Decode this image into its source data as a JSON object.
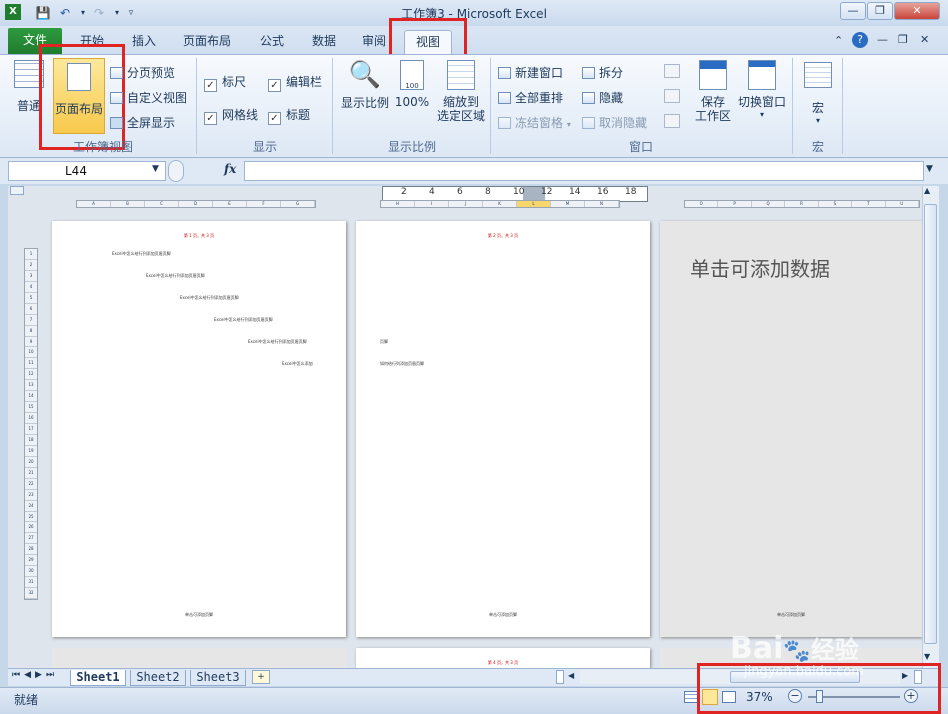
{
  "title": "工作簿3 - Microsoft Excel",
  "tabs": {
    "file": "文件",
    "home": "开始",
    "insert": "插入",
    "layout": "页面布局",
    "formula": "公式",
    "data": "数据",
    "review": "审阅",
    "view": "视图"
  },
  "ribbon": {
    "normal": "普通",
    "page_layout": "页面布局",
    "page_break": "分页预览",
    "custom_view": "自定义视图",
    "full_screen": "全屏显示",
    "group_views": "工作簿视图",
    "ruler": "标尺",
    "formula_bar": "编辑栏",
    "gridlines": "网格线",
    "headings": "标题",
    "group_show": "显示",
    "zoom": "显示比例",
    "zoom100": "100%",
    "zoom_sel_1": "缩放到",
    "zoom_sel_2": "选定区域",
    "group_zoom": "显示比例",
    "new_window": "新建窗口",
    "arrange_all": "全部重排",
    "freeze": "冻结窗格",
    "split": "拆分",
    "hide": "隐藏",
    "unhide": "取消隐藏",
    "save_ws_1": "保存",
    "save_ws_2": "工作区",
    "switch_win": "切换窗口",
    "group_window": "窗口",
    "macros": "宏",
    "group_macros": "宏",
    "icon_100": "100"
  },
  "namebox": "L44",
  "fx": "fx",
  "ruler_nums": [
    "2",
    "4",
    "6",
    "8",
    "10",
    "12",
    "14",
    "16",
    "18"
  ],
  "col_letters_p1": [
    "A",
    "B",
    "C",
    "D",
    "E",
    "F",
    "G"
  ],
  "col_letters_p2": [
    "H",
    "I",
    "J",
    "K",
    "L",
    "M",
    "N"
  ],
  "col_letters_p3": [
    "O",
    "P",
    "Q",
    "R",
    "S",
    "T",
    "U"
  ],
  "row_nums": [
    "1",
    "2",
    "3",
    "4",
    "5",
    "6",
    "7",
    "8",
    "9",
    "10",
    "11",
    "12",
    "13",
    "14",
    "15",
    "16",
    "17",
    "18",
    "19",
    "20",
    "21",
    "22",
    "23",
    "24",
    "25",
    "26",
    "27",
    "28",
    "29",
    "30",
    "31",
    "32"
  ],
  "page1": {
    "header": "第 1 页，共 3 页",
    "lines": [
      "Excel中怎么给行列添加页眉页脚",
      "Excel中怎么给行列添加页眉页脚",
      "Excel中怎么给行列添加页眉页脚",
      "Excel中怎么给行列添加页眉页脚",
      "Excel中怎么给行列添加页眉页脚",
      "Excel中怎么添加"
    ],
    "footer": "单击可添加页脚"
  },
  "page2": {
    "header": "第 2 页，共 3 页",
    "line1": "页脚",
    "line2": "如何给行列添加页眉页脚",
    "footer": "单击可添加页脚"
  },
  "page3": {
    "placeholder": "单击可添加数据",
    "footer": "单击可添加页脚"
  },
  "page5": {
    "header": "第 4 页，共 3 页"
  },
  "sheets": [
    "Sheet1",
    "Sheet2",
    "Sheet3"
  ],
  "status": {
    "ready": "就绪",
    "zoom": "37%"
  },
  "watermark": {
    "brand": "Bai",
    "brand2": "经验",
    "url": "jingyan.baidu.com"
  }
}
